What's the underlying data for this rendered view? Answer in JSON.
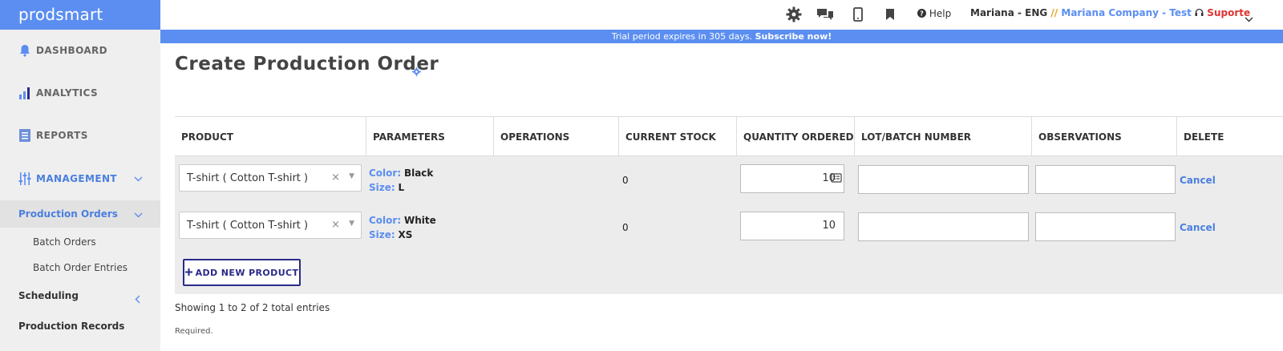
{
  "app": {
    "logo": "prodsmart"
  },
  "sidebar": {
    "dashboard": "DASHBOARD",
    "analytics": "ANALYTICS",
    "reports": "REPORTS",
    "management": "MANAGEMENT",
    "production_orders": "Production Orders",
    "batch_orders": "Batch Orders",
    "batch_order_entries": "Batch Order Entries",
    "scheduling": "Scheduling",
    "production_records": "Production Records"
  },
  "topbar": {
    "help": "Help",
    "user": "Mariana - ENG",
    "separator": "//",
    "company": "Mariana Company - Test",
    "support": "Suporte"
  },
  "trial": {
    "text": "Trial period expires in 305 days.",
    "link": "Subscribe now!"
  },
  "page": {
    "title": "Create Production Order"
  },
  "table": {
    "headers": [
      "PRODUCT",
      "PARAMETERS",
      "OPERATIONS",
      "CURRENT STOCK",
      "QUANTITY ORDERED",
      "LOT/BATCH NUMBER",
      "OBSERVATIONS",
      "DELETE"
    ],
    "rows": [
      {
        "product": "T-shirt ( Cotton T-shirt )",
        "color_label": "Color:",
        "color": "Black",
        "size_label": "Size:",
        "size": "L",
        "stock": "0",
        "quantity": "10",
        "lot": "",
        "observations": "",
        "delete": "Cancel"
      },
      {
        "product": "T-shirt ( Cotton T-shirt )",
        "color_label": "Color:",
        "color": "White",
        "size_label": "Size:",
        "size": "XS",
        "stock": "0",
        "quantity": "10",
        "lot": "",
        "observations": "",
        "delete": "Cancel"
      }
    ],
    "add_button": "ADD NEW PRODUCT",
    "showing": "Showing 1 to 2 of 2 total entries",
    "required": "Required."
  },
  "colors": {
    "accent": "#5b8ef0",
    "brand_dark": "#2a2a8a",
    "support": "#dd3333",
    "separator": "#e8a020"
  }
}
